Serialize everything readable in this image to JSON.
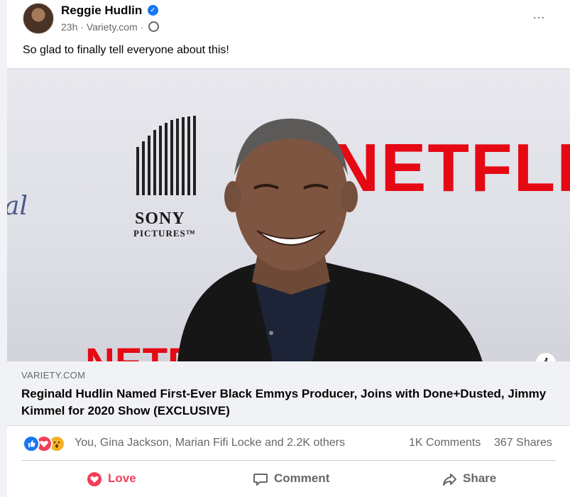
{
  "post": {
    "author": "Reggie Hudlin",
    "timestamp": "23h",
    "source": "Variety.com",
    "caption": "So glad to finally tell everyone about this!",
    "more_icon": "…"
  },
  "image": {
    "backdrop_texts": {
      "netflix": "NETFLIX",
      "netflix_partial": "NETF",
      "sony": "SONY",
      "pictures": "PICTURES™",
      "script_fragment": "al"
    },
    "info_label": "i"
  },
  "link": {
    "domain": "VARIETY.COM",
    "title": "Reginald Hudlin Named First-Ever Black Emmys Producer, Joins with Done+Dusted, Jimmy Kimmel for 2020 Show (EXCLUSIVE)"
  },
  "engagement": {
    "reactors": "You, Gina Jackson, Marian Fifi Locke and 2.2K others",
    "comments": "1K Comments",
    "shares": "367 Shares"
  },
  "actions": {
    "love": "Love",
    "comment": "Comment",
    "share": "Share"
  },
  "colors": {
    "love": "#f33e58",
    "like": "#1877f2",
    "wow": "#f7b125",
    "netflix_red": "#e50914"
  }
}
